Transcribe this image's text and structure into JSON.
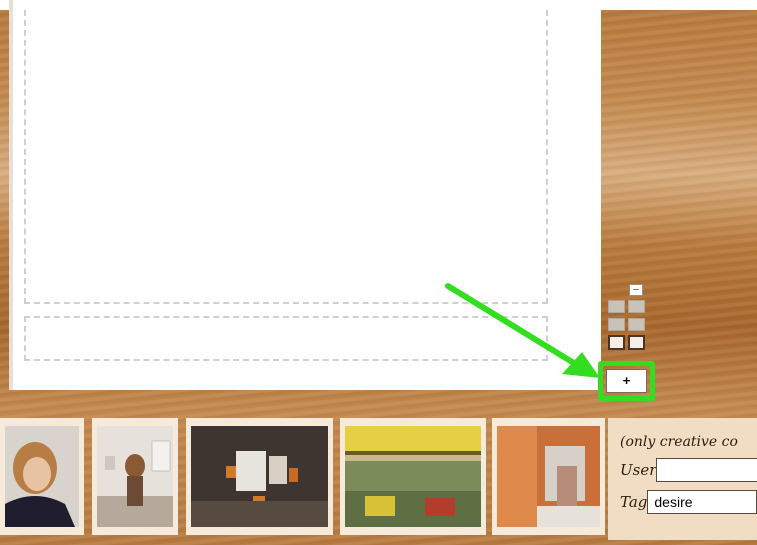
{
  "controls": {
    "minus_label": "–",
    "plus_label": "+"
  },
  "search": {
    "note": "(only creative co",
    "user_label": "User",
    "user_value": "",
    "tag_label": "Tag",
    "tag_value": "desire"
  },
  "thumbnails": [
    {
      "name": "thumbnail-woman-portrait"
    },
    {
      "name": "thumbnail-gallery-figure"
    },
    {
      "name": "thumbnail-dark-room"
    },
    {
      "name": "thumbnail-shop-shelves"
    },
    {
      "name": "thumbnail-orange-room"
    }
  ],
  "colors": {
    "highlight": "#33dd1f",
    "panel": "#f1dcc4"
  }
}
